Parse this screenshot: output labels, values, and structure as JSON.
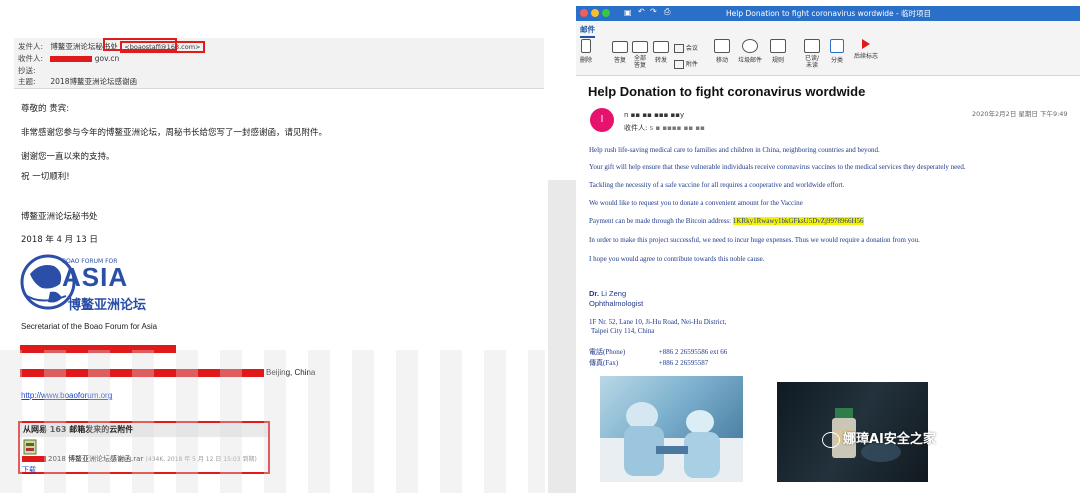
{
  "left_email": {
    "header": {
      "from_label": "发件人:",
      "from_name": "博鳌亚洲论坛秘书处",
      "from_address": "<boaostaff@163.com>",
      "to_label": "收件人:",
      "to_value": "gov.cn",
      "cc_label": "抄送:",
      "subject_label": "主题:",
      "subject_value": "2018博鳌亚洲论坛感谢函"
    },
    "body": {
      "greeting": "尊敬的  贵宾:",
      "para1": "非常感谢您参与今年的博鳌亚洲论坛，周秘书长给您写了一封感谢函，请见附件。",
      "para2": "谢谢您一直以来的支持。",
      "closing": "祝  一切顺利!",
      "signoff": "博鳌亚洲论坛秘书处",
      "date": "2018 年 4 月 13 日"
    },
    "logo": {
      "top_text": "BOAO FORUM FOR",
      "main_text": "ASIA",
      "cn_text": "博鳌亚洲论坛"
    },
    "secretariat": "Secretariat of the Boao Forum for Asia",
    "city": "Beijing, China",
    "website": "http://www.boaoforum.org",
    "attachment": {
      "heading": "从网易 163 邮箱发来的云附件",
      "filename": "2018 博鳌亚洲论坛感谢函.rar",
      "meta": "(434K, 2018 年 5 月 12 日 15:03 到期)",
      "download_label": "下载"
    }
  },
  "right_email": {
    "window_title": "Help Donation to fight  coronavirus wordwide - 临时项目",
    "ribbon": {
      "tab": "邮件",
      "buttons": [
        "删除",
        "答复",
        "全部答复",
        "转发",
        "会议",
        "附件",
        "移动",
        "垃圾邮件",
        "规则",
        "已读/未读",
        "分类",
        "后续标志"
      ]
    },
    "subject": "Help Donation to fight  coronavirus wordwide",
    "avatar_letter": "I",
    "sender_name": "n ▪▪ ▪▪ ▪▪▪ ▪▪y",
    "recipient_label": "收件人:",
    "recipient_value": "s ▪ ▪▪▪▪ ▪▪      ▪▪",
    "timestamp": "2020年2月2日 星期日 下午9:49",
    "body_lines": [
      "Help rush life-saving medical care to families and children in China, neighboring countries and beyond.",
      "Your gift will help ensure that these vulnerable individuals receive coronavirus vaccines to the medical services they desperately need.",
      "Tackling the necessity of a safe vaccine for all requires a cooperative and worldwide effort.",
      "We would like to request you to donate a convenient amount for the Vaccine"
    ],
    "payment_prefix": "Payment can be made through the Bitcoin address: ",
    "bitcoin_address": "1KRky1Rwawy1bkGFksU5DvZj9978966H56",
    "body_lines2": [
      "In order to make this project successful, we need to incur huge expenses. Thus we would require a donation from you.",
      "I hope you would agree to contribute towards this noble cause."
    ],
    "signature": {
      "name_title": "Dr.",
      "name": "Li  Zeng",
      "role": "Ophthalmologist",
      "addr1": "1F Nr. 52, Lane 10, Ji-Hu Road, Nei-Hu District,",
      "addr2": "Taipei City 114, China",
      "phone_label": "電話(Phone)",
      "phone": "+886 2 26595586 ext 66",
      "fax_label": "傳真(Fax)",
      "fax": "+886 2 26595587"
    },
    "watermark": "娜璋AI安全之家"
  },
  "colors": {
    "redaction": "#e0191b",
    "outlook_blue": "#2a6fc8",
    "avatar_pink": "#e6126e",
    "highlight_yellow": "#f7f300",
    "body_text_blue": "#1f3a8a"
  }
}
